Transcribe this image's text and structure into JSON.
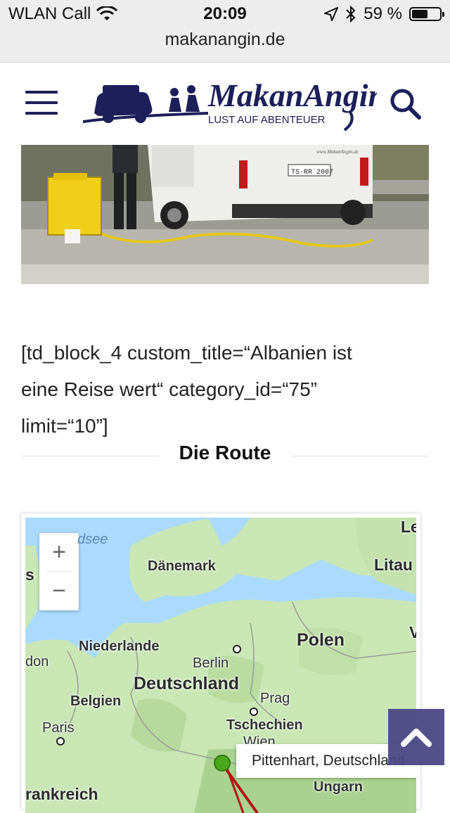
{
  "status_bar": {
    "carrier": "WLAN Call",
    "time": "20:09",
    "battery": "59 %",
    "battery_level": 0.59,
    "url": "makanangin.de"
  },
  "header": {
    "logo_name": "MakanAngin",
    "logo_tagline": "LUST AUF ABENTEUER",
    "menu_icon": "hamburger-icon",
    "search_icon": "search-icon"
  },
  "hero": {
    "plate_text": "TS·RR 2007",
    "van_text": "www.MakanAngin.de"
  },
  "content": {
    "shortcode_line1": "[td_block_4 custom_title=“Albanien ist",
    "shortcode_line2": "eine Reise wert“ category_id=“75”",
    "shortcode_line3": "limit=“10”]",
    "section_title": "Die Route"
  },
  "map": {
    "zoom_in": "+",
    "zoom_out": "−",
    "labels": {
      "nordsee": "dsee",
      "daenemark": "Dänemark",
      "litau": "Litau",
      "le": "Le",
      "niederlande": "Niederlande",
      "london": "don",
      "berlin": "Berlin",
      "polen": "Polen",
      "deutschland": "Deutschland",
      "belgien": "Belgien",
      "prag": "Prag",
      "paris": "Paris",
      "tschechien": "Tschechien",
      "wien": "Wien",
      "ungarn": "Ungarn",
      "frankreich": "rankreich",
      "s_left": "s",
      "v_right": "V"
    },
    "tooltip": "Pittenhart, Deutschland",
    "colors": {
      "water": "#aadaff",
      "land": "#c9e7b5",
      "route": "#b01515",
      "marker": "#4aa81a"
    }
  },
  "scroll_top": {
    "icon": "chevron-up-icon",
    "color": "#4b4786"
  }
}
